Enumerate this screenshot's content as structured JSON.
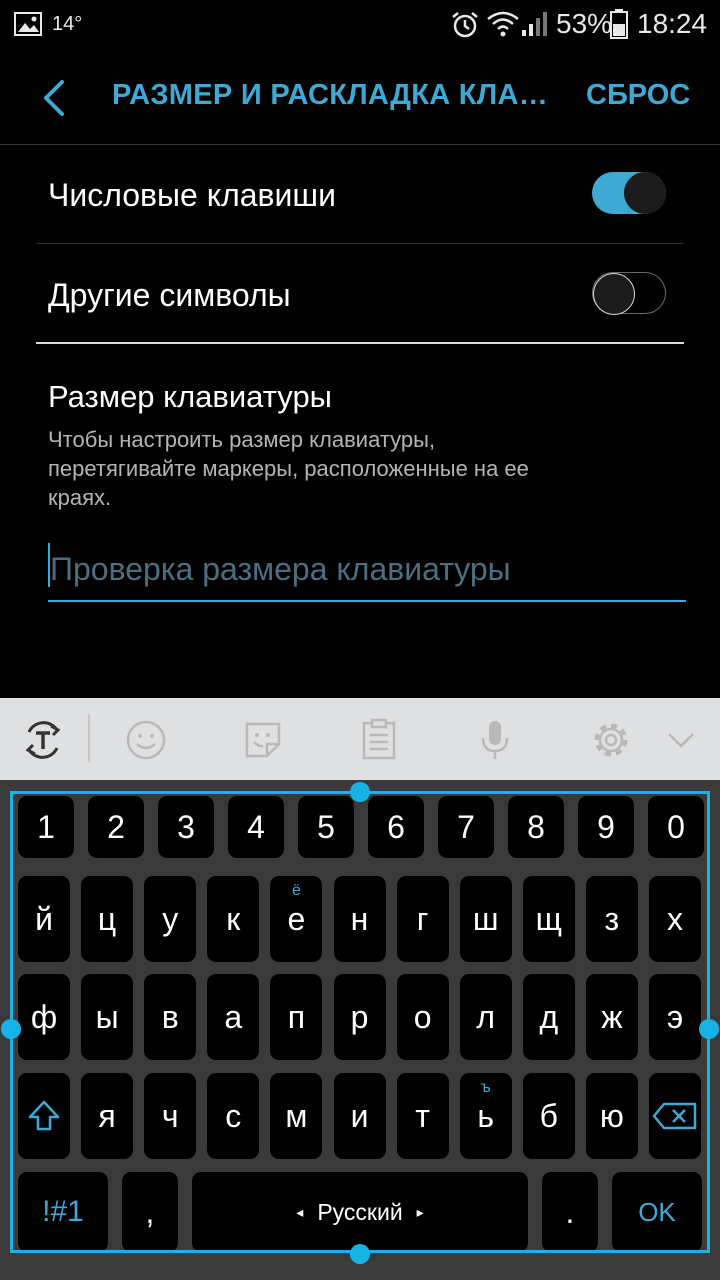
{
  "status_bar": {
    "temperature": "14°",
    "battery_percent": "53%",
    "time": "18:24"
  },
  "app_bar": {
    "title": "РАЗМЕР И РАСКЛАДКА КЛАВИАТУРЫ",
    "reset_label": "СБРОС"
  },
  "settings": {
    "numeric_keys": {
      "label": "Числовые клавиши",
      "enabled": true
    },
    "other_symbols": {
      "label": "Другие символы",
      "enabled": false
    }
  },
  "keyboard_size": {
    "title": "Размер клавиатуры",
    "description": "Чтобы настроить размер клавиатуры, перетягивайте маркеры, расположенные на ее краях.",
    "input_placeholder": "Проверка размера клавиатуры",
    "input_value": ""
  },
  "toolbar": {
    "icons": [
      "text-mode-icon",
      "emoji-icon",
      "sticker-icon",
      "clipboard-icon",
      "microphone-icon",
      "gear-icon",
      "chevron-down-icon"
    ]
  },
  "keyboard": {
    "number_row": [
      "1",
      "2",
      "3",
      "4",
      "5",
      "6",
      "7",
      "8",
      "9",
      "0"
    ],
    "row1": [
      "й",
      "ц",
      "у",
      "к",
      "е",
      "н",
      "г",
      "ш",
      "щ",
      "з",
      "х"
    ],
    "row1_secondary": {
      "4": "ё"
    },
    "row2": [
      "ф",
      "ы",
      "в",
      "а",
      "п",
      "р",
      "о",
      "л",
      "д",
      "ж",
      "э"
    ],
    "row3": [
      "я",
      "ч",
      "с",
      "м",
      "и",
      "т",
      "ь",
      "б",
      "ю"
    ],
    "row3_secondary": {
      "6": "ъ"
    },
    "symbols_label": "!#1",
    "comma_label": ",",
    "space_label": "Русский",
    "period_label": ".",
    "ok_label": "OK"
  },
  "colors": {
    "accent": "#3fa9d6",
    "frame": "#18b3e6",
    "keyboard_bg": "#3a3a3a",
    "toolbar_bg": "#dfe0e2"
  }
}
